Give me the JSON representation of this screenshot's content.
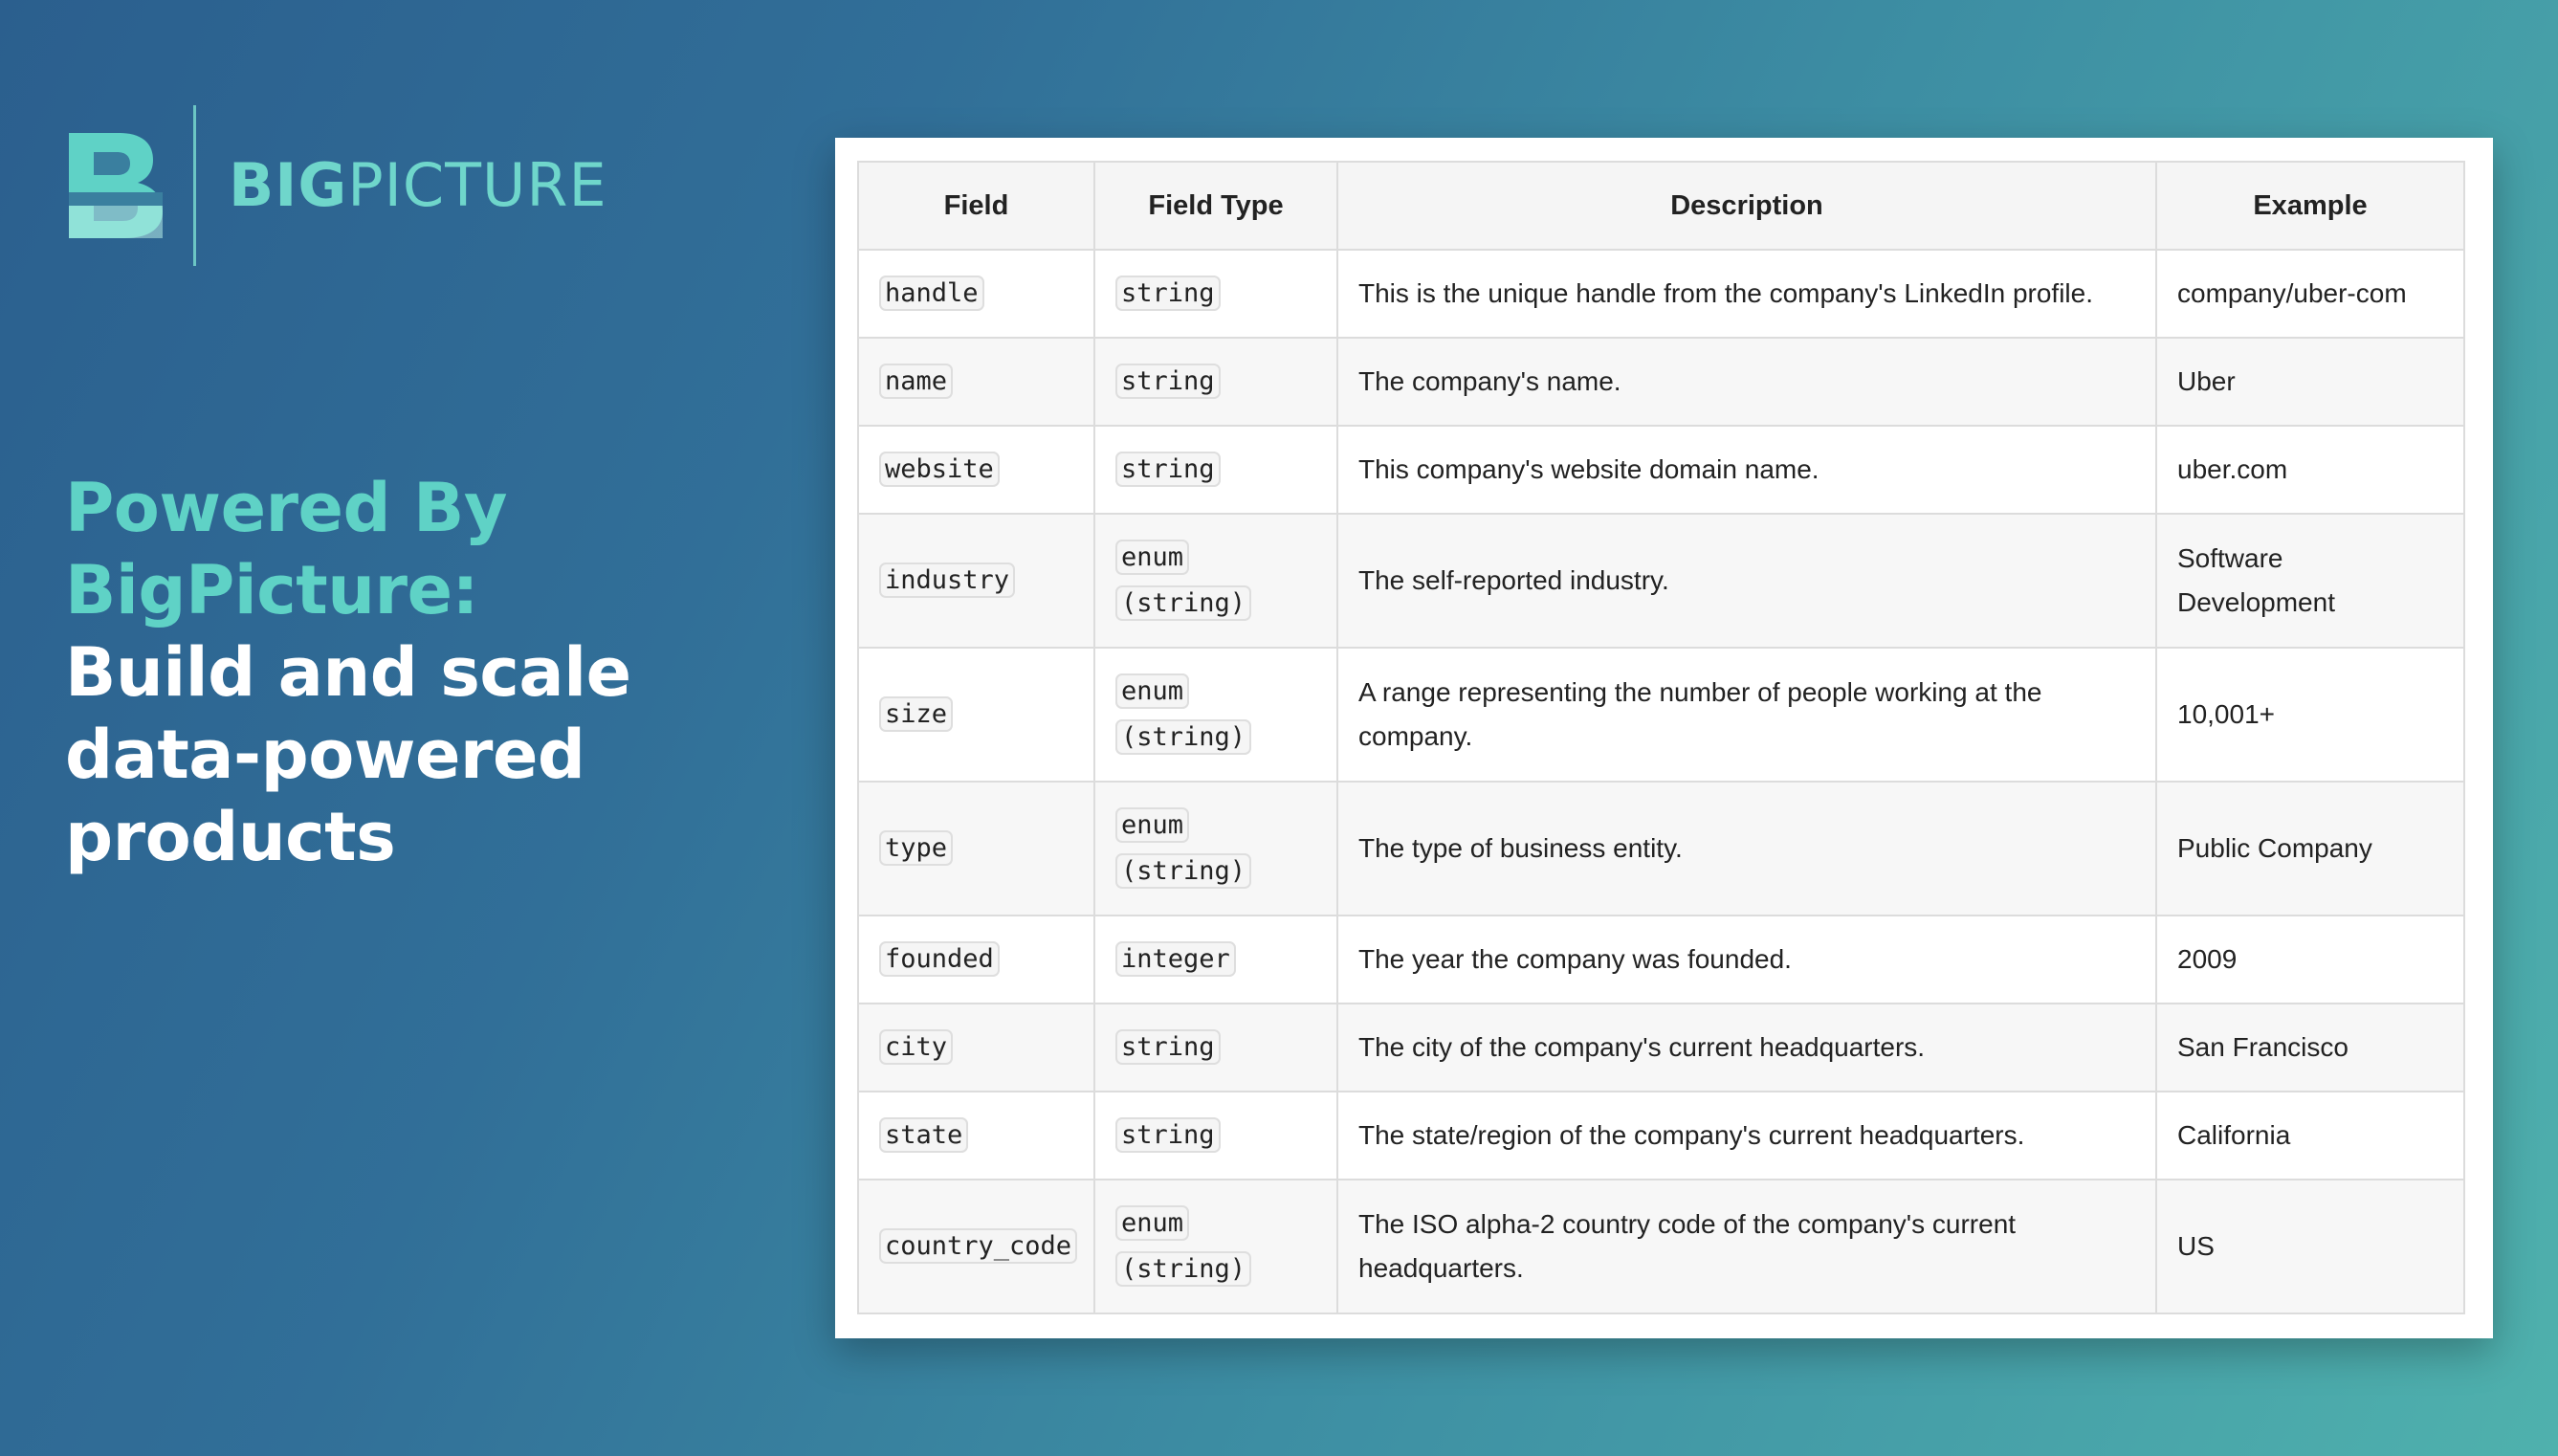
{
  "brand": {
    "name_bold": "BIG",
    "name_light": "PICTURE",
    "accent_color": "#5fd2c6"
  },
  "headline": {
    "line1": "Powered By BigPicture:",
    "line2": "Build and scale",
    "line3": "data-powered products"
  },
  "table": {
    "headers": [
      "Field",
      "Field Type",
      "Description",
      "Example"
    ],
    "rows": [
      {
        "field": "handle",
        "type": "string",
        "description": "This is the unique handle from the company's LinkedIn profile.",
        "example": "company/uber-com"
      },
      {
        "field": "name",
        "type": "string",
        "description": "The company's name.",
        "example": "Uber"
      },
      {
        "field": "website",
        "type": "string",
        "description": "This company's website domain name.",
        "example": "uber.com"
      },
      {
        "field": "industry",
        "type": "enum (string)",
        "description": "The self-reported industry.",
        "example": "Software Development"
      },
      {
        "field": "size",
        "type": "enum (string)",
        "description": "A range representing the number of people working at the company.",
        "example": "10,001+"
      },
      {
        "field": "type",
        "type": "enum (string)",
        "description": "The type of business entity.",
        "example": "Public Company"
      },
      {
        "field": "founded",
        "type": "integer",
        "description": "The year the company was founded.",
        "example": "2009"
      },
      {
        "field": "city",
        "type": "string",
        "description": "The city of the company's current headquarters.",
        "example": "San Francisco"
      },
      {
        "field": "state",
        "type": "string",
        "description": "The state/region of the company's current headquarters.",
        "example": "California"
      },
      {
        "field": "country_code",
        "type": "enum (string)",
        "description": "The ISO alpha-2 country code of the company's current headquarters.",
        "example": "US"
      }
    ]
  }
}
